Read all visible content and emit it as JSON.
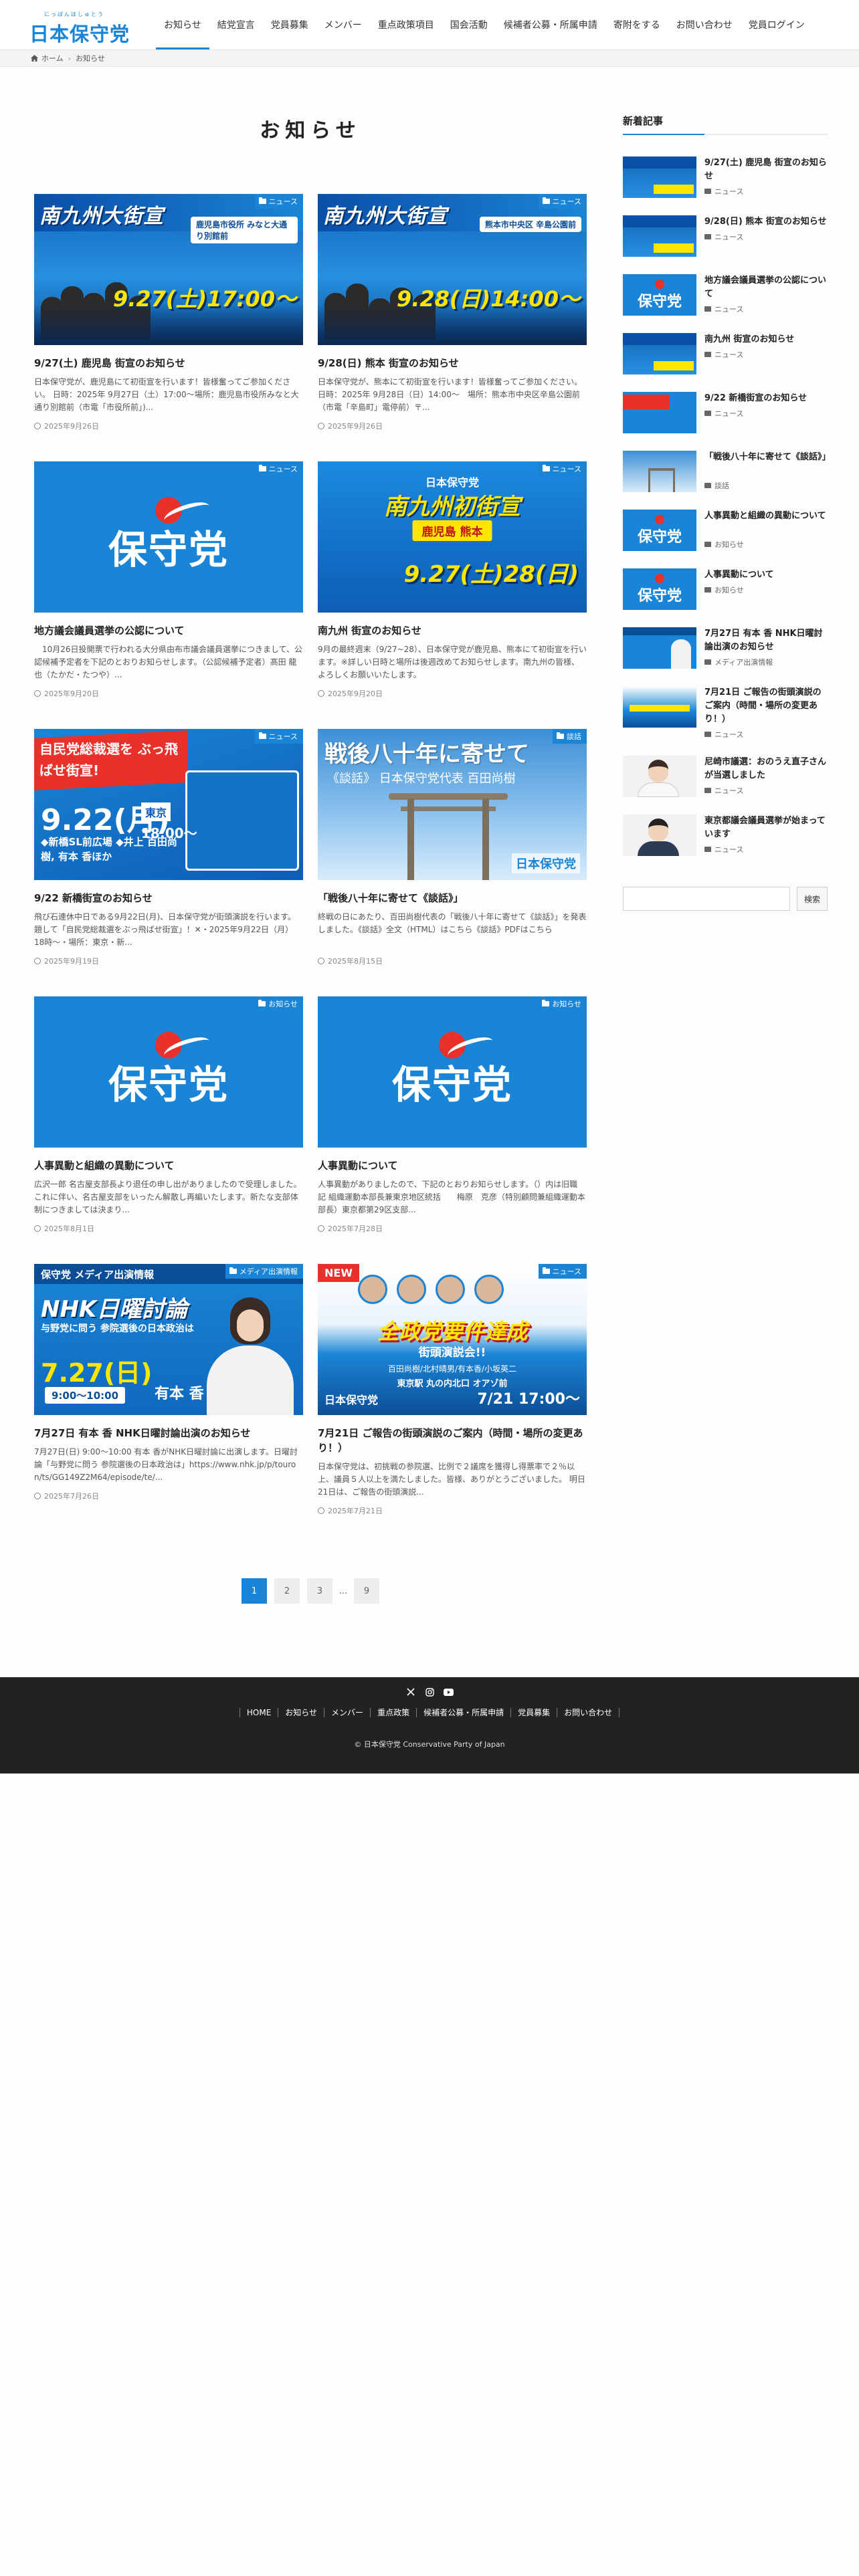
{
  "header": {
    "logo_ruby": "にっぽんほしゅとう",
    "logo_text": "日本保守党",
    "nav": [
      "お知らせ",
      "結党宣言",
      "党員募集",
      "メンバー",
      "重点政策項目",
      "国会活動",
      "候補者公募・所属申請",
      "寄附をする",
      "お問い合わせ",
      "党員ログイン"
    ]
  },
  "breadcrumb": {
    "home": "ホーム",
    "current": "お知らせ"
  },
  "page_title": "お知らせ",
  "cards": [
    {
      "category": "ニュース",
      "thumb": {
        "title": "南九州大街宣",
        "loc": "鹿児島市役所 みなと大通り別館前",
        "date": "9.27(土)17:00～"
      },
      "title": "9/27(土) 鹿児島 街宣のお知らせ",
      "excerpt": "日本保守党が、鹿児島にて初街宣を行います！皆様奮ってご参加ください。 日時：2025年 9月27日（土）17:00～場所：鹿児島市役所みなと大通り別館前（市電「市役所前」)...",
      "date": "2025年9月26日"
    },
    {
      "category": "ニュース",
      "thumb": {
        "title": "南九州大街宣",
        "loc": "熊本市中央区 辛島公園前",
        "date": "9.28(日)14:00～"
      },
      "title": "9/28(日) 熊本 街宣のお知らせ",
      "excerpt": "日本保守党が、熊本にて初街宣を行います！皆様奮ってご参加ください。 日時：2025年 9月28日（日）14:00～　場所：熊本市中央区辛島公園前（市電「辛島町」電停前）〒...",
      "date": "2025年9月26日"
    },
    {
      "category": "ニュース",
      "thumb": {
        "kanji": "保守党"
      },
      "title": "地方議会議員選挙の公認について",
      "excerpt": "　10月26日投開票で行われる大分県由布市議会議員選挙につきまして、公認候補予定者を下記のとおりお知らせします。（公認候補予定者）髙田 龍也（たかだ・たつや）...",
      "date": "2025年9月20日"
    },
    {
      "category": "ニュース",
      "thumb": {
        "top": "日本保守党",
        "big": "南九州初街宣",
        "pill": "鹿児島 熊本",
        "date": "9.27(土)28(日)"
      },
      "title": "南九州 街宣のお知らせ",
      "excerpt": "9月の最終週末（9/27~28）、日本保守党が鹿児島、熊本にて初街宣を行います。※詳しい日時と場所は後週改めてお知らせします。南九州の皆様、よろしくお願いいたします。",
      "date": "2025年9月20日"
    },
    {
      "category": "ニュース",
      "thumb": {
        "red": "自民党総裁選を ぶっ飛ばせ街宣!",
        "date": "9.22(月)",
        "time": "18:00～",
        "tokyo": "東京",
        "sub": "◆新橋SL前広場 ◆井上 百田尚樹, 有本 香ほか"
      },
      "title": "9/22 新橋街宣のお知らせ",
      "excerpt": "飛び石連休中日である9月22日(月)、日本保守党が街頭演説を行います。題して「自民党総裁選をぶっ飛ばせ街宣」！✕・2025年9月22日（月）18時〜・場所：東京・新...",
      "date": "2025年9月19日"
    },
    {
      "category": "談話",
      "thumb": {
        "title": "戦後八十年に寄せて",
        "sub": "《談話》 日本保守党代表 百田尚樹",
        "brand": "日本保守党"
      },
      "title": "「戦後八十年に寄せて《談話》」",
      "excerpt": "終戦の日にあたり、百田尚樹代表の「戦後八十年に寄せて《談話》」を発表しました。《談話》全文（HTML）はこちら《談話》PDFはこちら",
      "date": "2025年8月15日"
    },
    {
      "category": "お知らせ",
      "thumb": {
        "kanji": "保守党"
      },
      "title": "人事異動と組織の異動について",
      "excerpt": "広沢一郎 名古屋支部長より退任の申し出がありましたので受理しました。これに伴い、名古屋支部をいったん解散し再編いたします。新たな支部体制につきましては決まり...",
      "date": "2025年8月1日"
    },
    {
      "category": "お知らせ",
      "thumb": {
        "kanji": "保守党"
      },
      "title": "人事異動について",
      "excerpt": "人事異動がありましたので、下記のとおりお知らせします。（）内は旧職 記 組織運動本部長兼東京地区統括　　梅原　克彦（特別顧問兼組織運動本部長）東京都第29区支部...",
      "date": "2025年7月28日"
    },
    {
      "category": "メディア出演情報",
      "thumb": {
        "bar": "保守党 メディア出演情報",
        "nhk": "NHK日曜討論",
        "sub": "与野党に問う 参院選後の日本政治は",
        "date": "7.27(日)",
        "time": "9:00～10:00",
        "name": "有本 香"
      },
      "title": "7月27日 有本 香 NHK日曜討論出演のお知らせ",
      "excerpt": "7月27日(日) 9:00〜10:00 有本 香がNHK日曜討論に出演します。日曜討論「与野党に問う 参院選後の日本政治は」https://www.nhk.jp/p/touron/ts/GG149Z2M64/episode/te/...",
      "date": "2025年7月26日"
    },
    {
      "category": "ニュース",
      "thumb": {
        "new": "NEW",
        "big": "全政党要件達成",
        "sub": "街頭演説会!!",
        "names": "百田尚樹/北村晴男/有本香/小坂英二",
        "when": "7/21 17:00～",
        "brand": "日本保守党",
        "place": "東京駅 丸の内北口 オアゾ前"
      },
      "title": "7月21日 ご報告の街頭演説のご案内（時間・場所の変更あり！）",
      "excerpt": "日本保守党は、初挑戦の参院選、比例で２議席を獲得し得票率で２％以上、議員５人以上を満たしました。皆様、ありがとうございました。 明日21日は、ご報告の街頭演説...",
      "date": "2025年7月21日"
    }
  ],
  "pagination": [
    "1",
    "2",
    "3",
    "...",
    "9"
  ],
  "sidebar": {
    "title": "新着記事",
    "items": [
      {
        "title": "9/27(土) 鹿児島 街宣のお知らせ",
        "category": "ニュース"
      },
      {
        "title": "9/28(日) 熊本 街宣のお知らせ",
        "category": "ニュース"
      },
      {
        "title": "地方議会議員選挙の公認について",
        "category": "ニュース"
      },
      {
        "title": "南九州 街宣のお知らせ",
        "category": "ニュース"
      },
      {
        "title": "9/22 新橋街宣のお知らせ",
        "category": "ニュース"
      },
      {
        "title": "「戦後八十年に寄せて《談話》」",
        "category": "談話"
      },
      {
        "title": "人事異動と組織の異動について",
        "category": "お知らせ"
      },
      {
        "title": "人事異動について",
        "category": "お知らせ"
      },
      {
        "title": "7月27日 有本 香 NHK日曜討論出演のお知らせ",
        "category": "メディア出演情報"
      },
      {
        "title": "7月21日 ご報告の街頭演説のご案内（時間・場所の変更あり！）",
        "category": "ニュース"
      },
      {
        "title": "尼崎市議選：おのうえ直子さんが当選しました",
        "category": "ニュース"
      },
      {
        "title": "東京都議会議員選挙が始まっています",
        "category": "ニュース"
      }
    ],
    "search_button": "検索"
  },
  "footer": {
    "social": [
      "x-icon",
      "instagram-icon",
      "youtube-icon"
    ],
    "links": [
      "HOME",
      "お知らせ",
      "メンバー",
      "重点政策",
      "候補者公募・所属申請",
      "党員募集",
      "お問い合わせ"
    ],
    "copyright": "© 日本保守党 Conservative Party of Japan"
  },
  "colors": {
    "brand": "#1a85d6",
    "accent_red": "#e8312a",
    "highlight": "#ffe600",
    "footer_bg": "#222222"
  }
}
